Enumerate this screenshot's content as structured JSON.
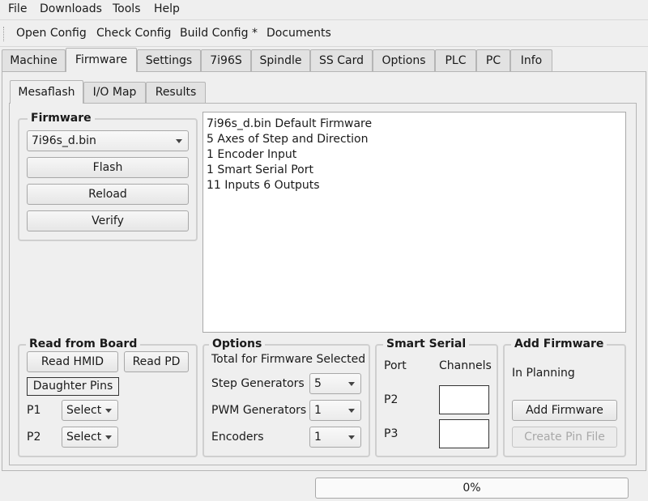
{
  "menu": {
    "file": "File",
    "downloads": "Downloads",
    "tools": "Tools",
    "help": "Help"
  },
  "toolbar": {
    "open": "Open Config",
    "check": "Check Config",
    "build": "Build Config *",
    "docs": "Documents"
  },
  "tabs": [
    "Machine",
    "Firmware",
    "Settings",
    "7i96S",
    "Spindle",
    "SS Card",
    "Options",
    "PLC",
    "PC",
    "Info"
  ],
  "active_tab": "Firmware",
  "subtabs": [
    "Mesaflash",
    "I/O Map",
    "Results"
  ],
  "active_subtab": "Mesaflash",
  "firmware": {
    "title": "Firmware",
    "selected": "7i96s_d.bin",
    "flash": "Flash",
    "reload": "Reload",
    "verify": "Verify"
  },
  "description": [
    "7i96s_d.bin Default Firmware",
    "5 Axes of Step and Direction",
    "1 Encoder Input",
    "1 Smart Serial Port",
    "11 Inputs 6 Outputs"
  ],
  "read_board": {
    "title": "Read from Board",
    "read_hmid": "Read HMID",
    "read_pd": "Read PD",
    "daughter_pins": "Daughter Pins",
    "p1_label": "P1",
    "p1_value": "Select",
    "p2_label": "P2",
    "p2_value": "Select"
  },
  "options": {
    "title": "Options",
    "total": "Total for Firmware Selected",
    "step_label": "Step Generators",
    "step_value": "5",
    "pwm_label": "PWM Generators",
    "pwm_value": "1",
    "enc_label": "Encoders",
    "enc_value": "1"
  },
  "smart_serial": {
    "title": "Smart Serial",
    "port": "Port",
    "channels": "Channels",
    "p2": "P2",
    "p3": "P3"
  },
  "add_firmware": {
    "title": "Add Firmware",
    "status": "In Planning",
    "add": "Add Firmware",
    "create": "Create Pin File"
  },
  "progress": {
    "text": "0%",
    "value": 0
  },
  "colors": {
    "accent": "#3daee9",
    "background": "#efefef"
  }
}
